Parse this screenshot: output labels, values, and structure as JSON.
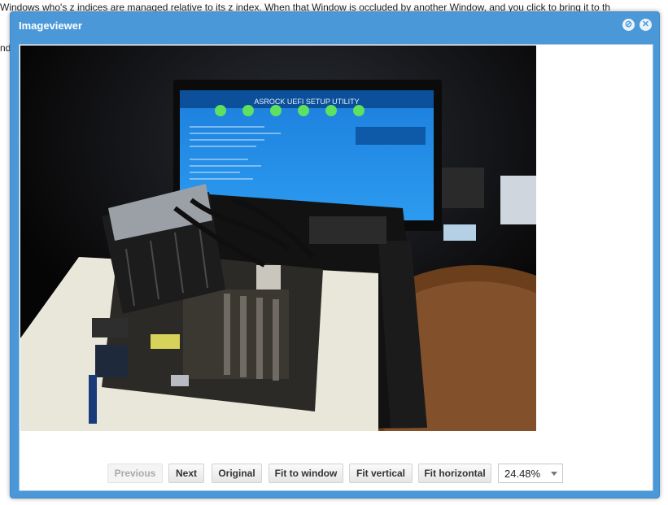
{
  "background": {
    "line1": "Windows who's z indices are managed relative to its z index. When that Window is occluded by another Window, and you click to bring it to th",
    "line2": "nd"
  },
  "window": {
    "title": "Imageviewer",
    "restore_icon": "restore-icon",
    "close_icon": "close-icon"
  },
  "image": {
    "subject": "motherboard-test-bench-photo",
    "monitor_title": "ASROCK UEFI SETUP UTILITY"
  },
  "toolbar": {
    "previous_label": "Previous",
    "next_label": "Next",
    "original_label": "Original",
    "fit_window_label": "Fit to window",
    "fit_vertical_label": "Fit vertical",
    "fit_horizontal_label": "Fit horizontal",
    "zoom_value": "24.48%"
  },
  "colors": {
    "window_accent": "#4a98d8",
    "title_text": "#ffffff",
    "disabled_text": "#a9a9a9"
  }
}
